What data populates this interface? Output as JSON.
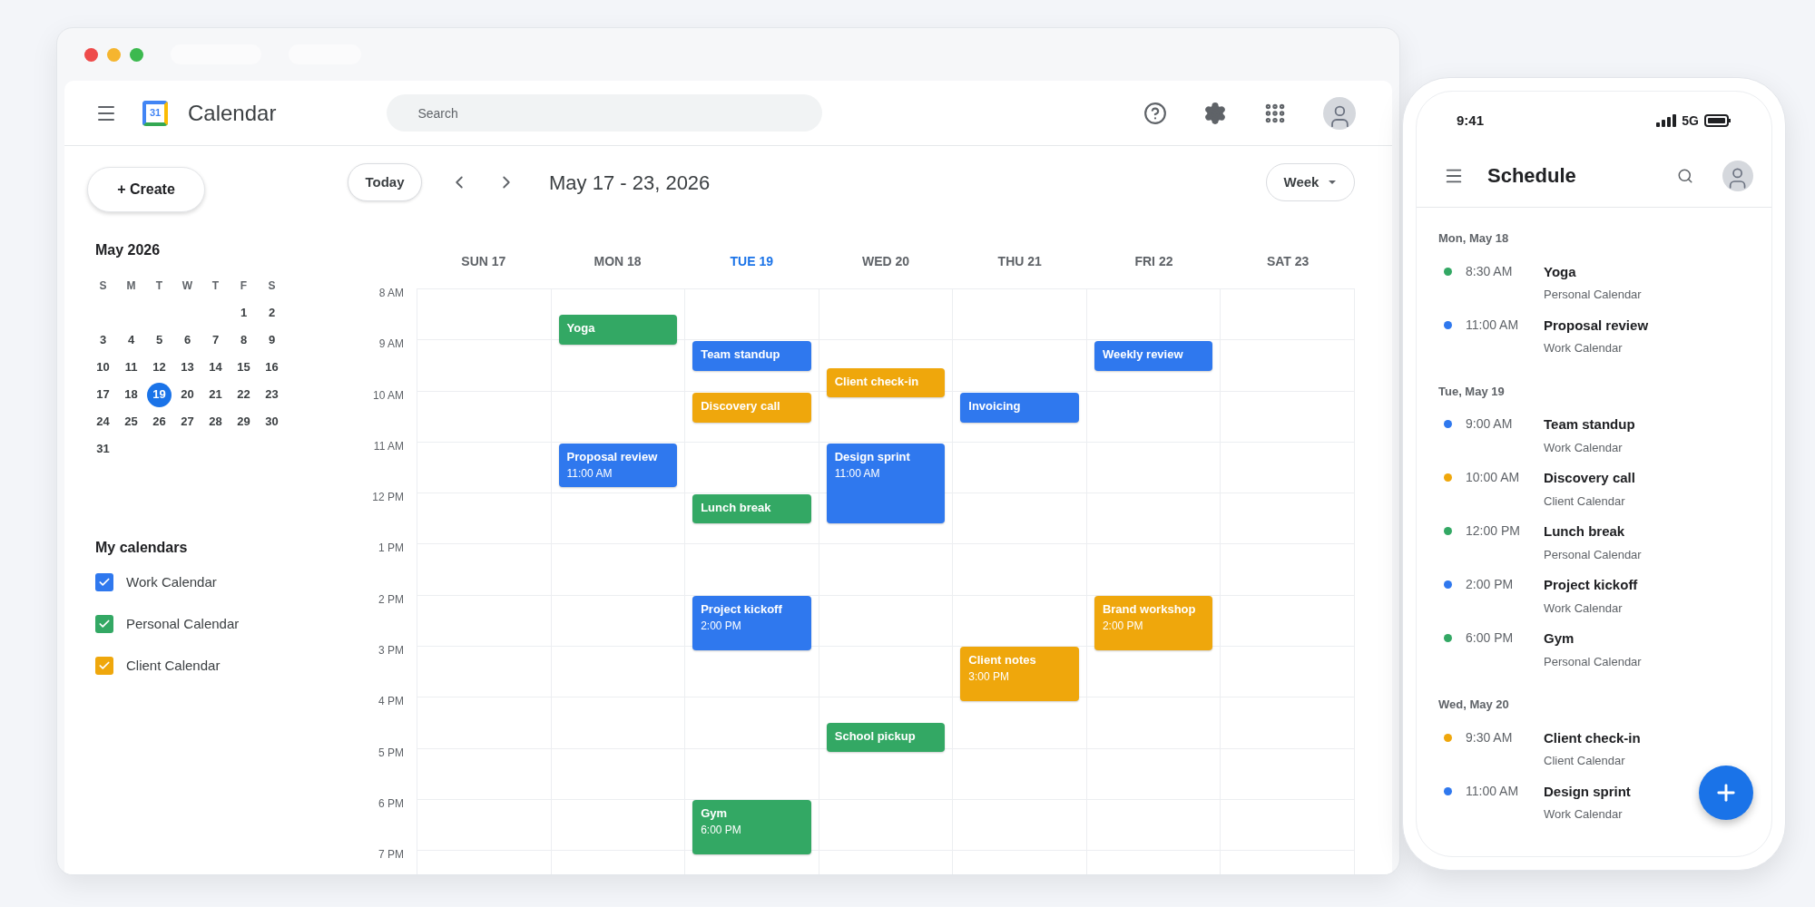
{
  "app": {
    "logo_text": "31",
    "title": "Calendar",
    "search": {
      "placeholder": "Search"
    }
  },
  "sidebar": {
    "create_label": "+ Create",
    "mini_calendar": {
      "title": "May 2026",
      "weekdays": [
        "S",
        "M",
        "T",
        "W",
        "T",
        "F",
        "S"
      ],
      "weeks": [
        [
          {
            "label": "1",
            "selected": false
          },
          {
            "label": "2",
            "selected": false
          }
        ],
        [
          {
            "label": "3",
            "selected": false
          },
          {
            "label": "4",
            "selected": false
          },
          {
            "label": "5",
            "selected": false
          },
          {
            "label": "6",
            "selected": false
          },
          {
            "label": "7",
            "selected": false
          },
          {
            "label": "8",
            "selected": false
          },
          {
            "label": "9",
            "selected": false
          }
        ],
        [
          {
            "label": "10",
            "selected": false
          },
          {
            "label": "11",
            "selected": false
          },
          {
            "label": "12",
            "selected": false
          },
          {
            "label": "13",
            "selected": false
          },
          {
            "label": "14",
            "selected": false
          },
          {
            "label": "15",
            "selected": false
          },
          {
            "label": "16",
            "selected": false
          }
        ],
        [
          {
            "label": "17",
            "selected": false
          },
          {
            "label": "18",
            "selected": false
          },
          {
            "label": "19",
            "selected": true
          },
          {
            "label": "20",
            "selected": false
          },
          {
            "label": "21",
            "selected": false
          },
          {
            "label": "22",
            "selected": false
          },
          {
            "label": "23",
            "selected": false
          }
        ],
        [
          {
            "label": "24",
            "selected": false
          },
          {
            "label": "25",
            "selected": false
          },
          {
            "label": "26",
            "selected": false
          },
          {
            "label": "27",
            "selected": false
          },
          {
            "label": "28",
            "selected": false
          },
          {
            "label": "29",
            "selected": false
          },
          {
            "label": "30",
            "selected": false
          }
        ],
        [
          {
            "label": "31",
            "selected": false
          }
        ]
      ]
    },
    "calendars_title": "My calendars",
    "calendars": [
      {
        "label": "Work Calendar",
        "checked": true,
        "color": "#2f78ee"
      },
      {
        "label": "Personal Calendar",
        "checked": true,
        "color": "#33a864"
      },
      {
        "label": "Client Calendar",
        "checked": true,
        "color": "#efa70c"
      }
    ]
  },
  "toolbar": {
    "today": "Today",
    "range": "May 17 - 23, 2026",
    "view": "Week"
  },
  "hours": [
    "8 AM",
    "9 AM",
    "10 AM",
    "11 AM",
    "12 PM",
    "1 PM",
    "2 PM",
    "3 PM",
    "4 PM",
    "5 PM",
    "6 PM",
    "7 PM"
  ],
  "days": [
    {
      "label": "SUN 17",
      "selected": false
    },
    {
      "label": "MON 18",
      "selected": false,
      "events": [
        {
          "title": "Yoga",
          "color": "#33a864"
        },
        {
          "title": "Proposal review",
          "time": "11:00 AM",
          "color": "#2f78ee"
        }
      ]
    },
    {
      "label": "TUE 19",
      "selected": true,
      "events": [
        {
          "title": "Team standup",
          "color": "#2f78ee"
        },
        {
          "title": "Discovery call",
          "color": "#efa70c"
        },
        {
          "title": "Lunch break",
          "color": "#33a864"
        },
        {
          "title": "Project kickoff",
          "time": "2:00 PM",
          "color": "#2f78ee"
        },
        {
          "title": "Gym",
          "time": "6:00 PM",
          "color": "#33a864"
        }
      ]
    },
    {
      "label": "WED 20",
      "selected": false,
      "events": [
        {
          "title": "Client check-in",
          "color": "#efa70c"
        },
        {
          "title": "Design sprint",
          "time": "11:00 AM",
          "color": "#2f78ee"
        },
        {
          "title": "School pickup",
          "color": "#33a864"
        }
      ]
    },
    {
      "label": "THU 21",
      "selected": false,
      "events": [
        {
          "title": "Invoicing",
          "color": "#2f78ee"
        },
        {
          "title": "Client notes",
          "time": "3:00 PM",
          "color": "#efa70c"
        }
      ]
    },
    {
      "label": "FRI 22",
      "selected": false,
      "events": [
        {
          "title": "Weekly review",
          "color": "#2f78ee"
        },
        {
          "title": "Brand workshop",
          "time": "2:00 PM",
          "color": "#efa70c"
        }
      ]
    },
    {
      "label": "SAT 23",
      "selected": false
    }
  ],
  "phone": {
    "clock": "9:41",
    "network": "5G",
    "title": "Schedule",
    "agenda": [
      {
        "label": "Mon, May 18",
        "events": [
          {
            "time": "8:30 AM",
            "title": "Yoga",
            "calendar": "Personal Calendar",
            "color": "#33a864"
          },
          {
            "time": "11:00 AM",
            "title": "Proposal review",
            "calendar": "Work Calendar",
            "color": "#2f78ee"
          }
        ]
      },
      {
        "label": "Tue, May 19",
        "events": [
          {
            "time": "9:00 AM",
            "title": "Team standup",
            "calendar": "Work Calendar",
            "color": "#2f78ee"
          },
          {
            "time": "10:00 AM",
            "title": "Discovery call",
            "calendar": "Client Calendar",
            "color": "#efa70c"
          },
          {
            "time": "12:00 PM",
            "title": "Lunch break",
            "calendar": "Personal Calendar",
            "color": "#33a864"
          },
          {
            "time": "2:00 PM",
            "title": "Project kickoff",
            "calendar": "Work Calendar",
            "color": "#2f78ee"
          },
          {
            "time": "6:00 PM",
            "title": "Gym",
            "calendar": "Personal Calendar",
            "color": "#33a864"
          }
        ]
      },
      {
        "label": "Wed, May 20",
        "events": [
          {
            "time": "9:30 AM",
            "title": "Client check-in",
            "calendar": "Client Calendar",
            "color": "#efa70c"
          },
          {
            "time": "11:00 AM",
            "title": "Design sprint",
            "calendar": "Work Calendar",
            "color": "#2f78ee"
          }
        ]
      }
    ]
  }
}
